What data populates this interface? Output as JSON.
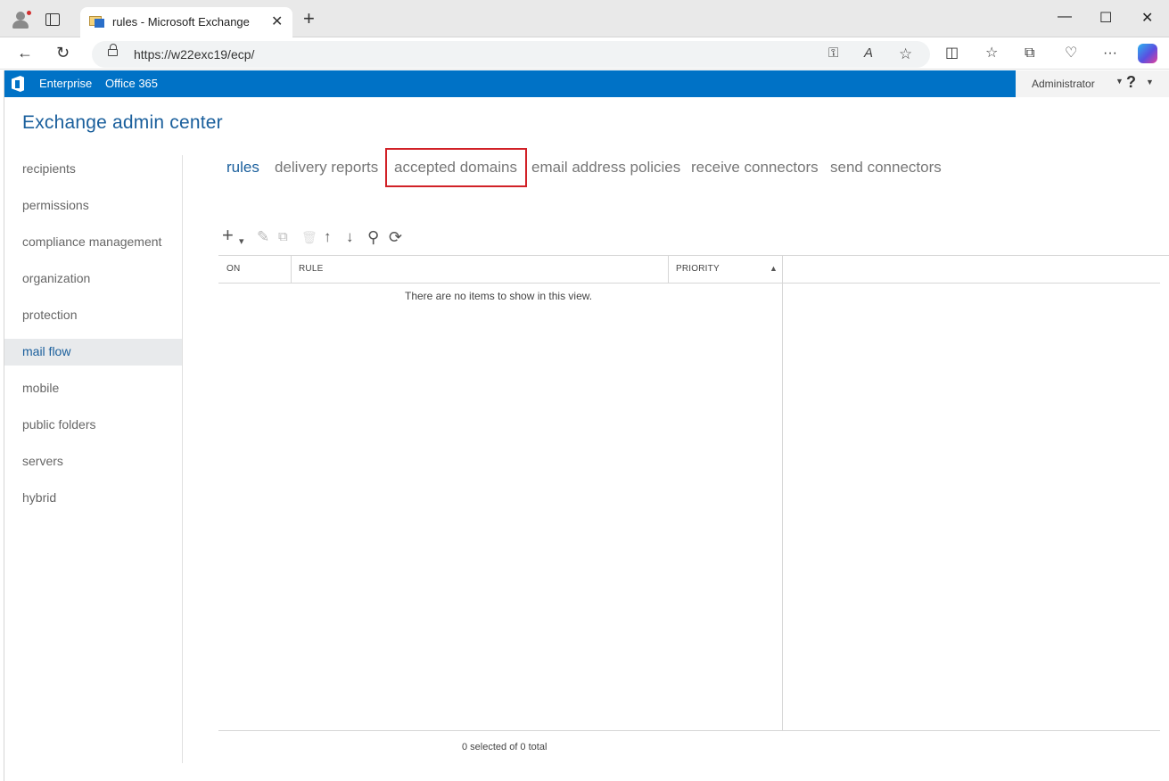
{
  "browser": {
    "tab_title": "rules - Microsoft Exchange",
    "tab_close": "✕",
    "new_tab": "+",
    "url": "https://w22exc19/ecp/",
    "window_controls": {
      "minimize": "—",
      "maximize": "☐",
      "close": "✕"
    },
    "nav": {
      "back": "←",
      "refresh": "↻"
    },
    "toolbar_glyphs": {
      "key": "⚿",
      "read_aloud": "A",
      "favorite": "☆",
      "split": "◫",
      "favorites_list": "☆",
      "collections": "⧉",
      "health": "♡",
      "more": "···"
    }
  },
  "o365": {
    "links": [
      "Enterprise",
      "Office 365"
    ],
    "user": "Administrator",
    "help": "?",
    "caret": "▼",
    "brand_color": "#0072c6"
  },
  "app": {
    "title": "Exchange admin center"
  },
  "leftnav": {
    "items": [
      {
        "label": "recipients",
        "selected": false
      },
      {
        "label": "permissions",
        "selected": false
      },
      {
        "label": "compliance management",
        "selected": false
      },
      {
        "label": "organization",
        "selected": false
      },
      {
        "label": "protection",
        "selected": false
      },
      {
        "label": "mail flow",
        "selected": true
      },
      {
        "label": "mobile",
        "selected": false
      },
      {
        "label": "public folders",
        "selected": false
      },
      {
        "label": "servers",
        "selected": false
      },
      {
        "label": "hybrid",
        "selected": false
      }
    ]
  },
  "subtabs": [
    {
      "label": "rules",
      "active": true
    },
    {
      "label": "delivery reports",
      "active": false
    },
    {
      "label": "accepted domains",
      "active": false,
      "highlighted": true
    },
    {
      "label": "email address policies",
      "active": false
    },
    {
      "label": "receive connectors",
      "active": false
    },
    {
      "label": "send connectors",
      "active": false
    }
  ],
  "toolbar": {
    "add": "+",
    "add_caret": "▾",
    "edit": "✎",
    "copy": "⧉",
    "delete": "🗑",
    "up": "↑",
    "down": "↓",
    "search": "⚲",
    "refresh": "⟳"
  },
  "grid": {
    "columns": [
      "ON",
      "RULE",
      "PRIORITY"
    ],
    "sort_indicator": "▲",
    "empty_message": "There are no items to show in this view.",
    "status": "0 selected of 0 total"
  },
  "colors": {
    "accent": "#1a5f9c",
    "highlight_border": "#d12127",
    "selected_nav_bg": "#e8eaec"
  }
}
